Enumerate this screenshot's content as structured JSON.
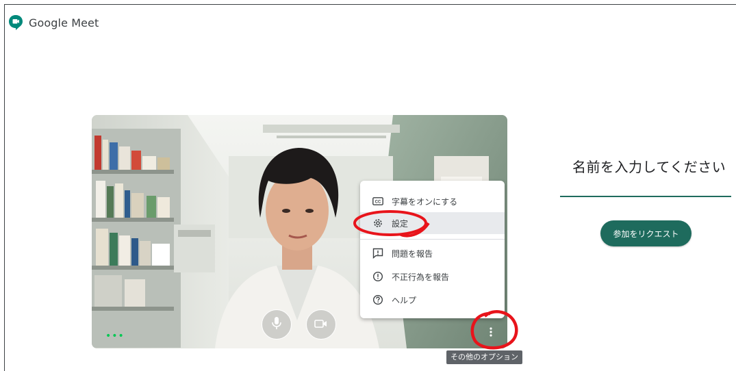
{
  "app": {
    "title": "Google Meet",
    "brand_color": "#00897B"
  },
  "preview": {
    "status_indicator": "•••",
    "mic_icon": "microphone-icon",
    "camera_icon": "video-camera-icon",
    "more_icon": "more-vert-icon",
    "more_tooltip": "その他のオプション"
  },
  "menu": {
    "items": [
      {
        "label": "字幕をオンにする",
        "icon": "closed-captions-icon"
      },
      {
        "label": "設定",
        "icon": "gear-icon"
      },
      {
        "label": "問題を報告",
        "icon": "feedback-icon"
      },
      {
        "label": "不正行為を報告",
        "icon": "report-icon"
      },
      {
        "label": "ヘルプ",
        "icon": "help-icon"
      }
    ]
  },
  "join": {
    "name_prompt": "名前を入力してください",
    "name_value": "",
    "request_button": "参加をリクエスト",
    "accent_color": "#1E6B5D"
  },
  "annotations": {
    "circle_color": "#E8141B"
  }
}
